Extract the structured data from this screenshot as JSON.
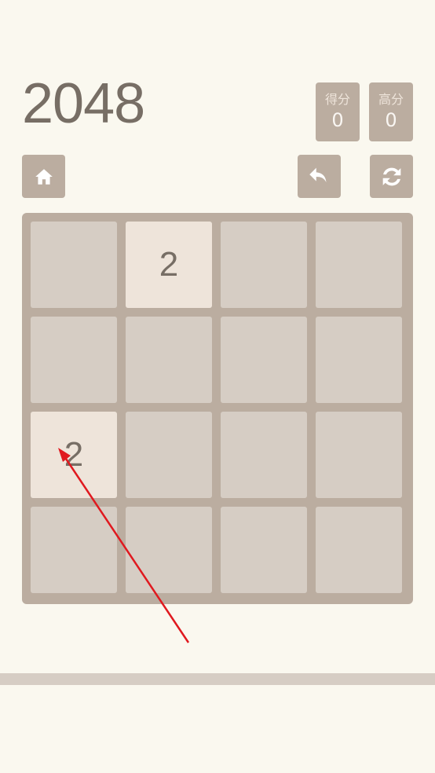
{
  "game": {
    "title": "2048"
  },
  "scores": {
    "score_label": "得分",
    "score_value": "0",
    "best_label": "高分",
    "best_value": "0"
  },
  "controls": {
    "home_icon": "home-icon",
    "undo_icon": "undo-icon",
    "restart_icon": "restart-icon"
  },
  "board": {
    "grid": [
      [
        "",
        "2",
        "",
        ""
      ],
      [
        "",
        "",
        "",
        ""
      ],
      [
        "2",
        "",
        "",
        ""
      ],
      [
        "",
        "",
        "",
        ""
      ]
    ]
  },
  "colors": {
    "background": "#faf8ef",
    "board": "#bbada0",
    "empty_cell": "#d6cdc4",
    "tile_2": "#eee4da",
    "text_dark": "#776e65",
    "annotation_arrow": "#e0191f"
  }
}
